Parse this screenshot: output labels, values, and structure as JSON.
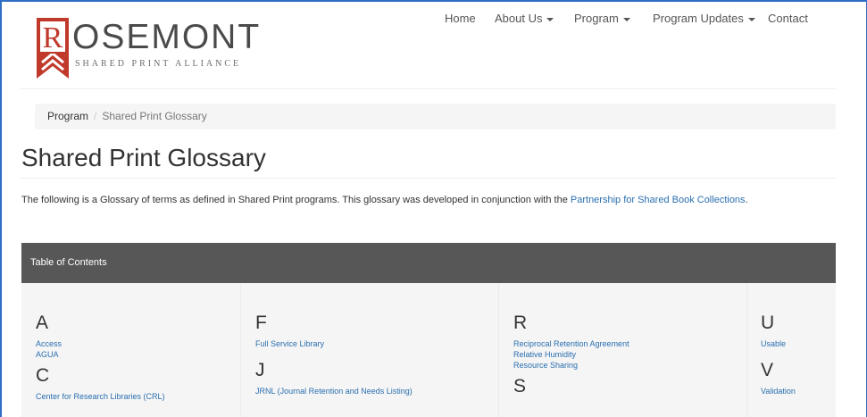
{
  "logo": {
    "initial": "R",
    "word": "OSEMONT",
    "tagline": "SHARED PRINT ALLIANCE",
    "brand_color": "#c0392b"
  },
  "nav": {
    "home": "Home",
    "about": "About Us",
    "program": "Program",
    "updates": "Program Updates",
    "contact": "Contact"
  },
  "breadcrumb": {
    "parent": "Program",
    "separator": "/",
    "current": "Shared Print Glossary"
  },
  "page": {
    "title": "Shared Print Glossary",
    "intro_text": "The following is a Glossary of terms as defined in Shared Print programs. This glossary was developed in conjunction with the ",
    "intro_link": "Partnership for Shared Book Collections",
    "intro_end": ".",
    "link_color": "#2a6fb0"
  },
  "toc": {
    "header": "Table of Contents",
    "header_color": "#575757",
    "columns": [
      {
        "groups": [
          {
            "letter": "A",
            "terms": [
              "Access",
              "AGUA"
            ]
          },
          {
            "letter": "C",
            "terms": [
              "Center for Research Libraries (CRL)"
            ]
          }
        ]
      },
      {
        "groups": [
          {
            "letter": "F",
            "terms": [
              "Full Service Library"
            ]
          },
          {
            "letter": "J",
            "terms": [
              "JRNL (Journal Retention and Needs Listing)"
            ]
          }
        ]
      },
      {
        "groups": [
          {
            "letter": "R",
            "terms": [
              "Reciprocal Retention Agreement",
              "Relative Humidity",
              "Resource Sharing"
            ]
          },
          {
            "letter": "S",
            "terms": []
          }
        ]
      },
      {
        "groups": [
          {
            "letter": "U",
            "terms": [
              "Usable"
            ]
          },
          {
            "letter": "V",
            "terms": [
              "Validation"
            ]
          }
        ]
      }
    ]
  }
}
